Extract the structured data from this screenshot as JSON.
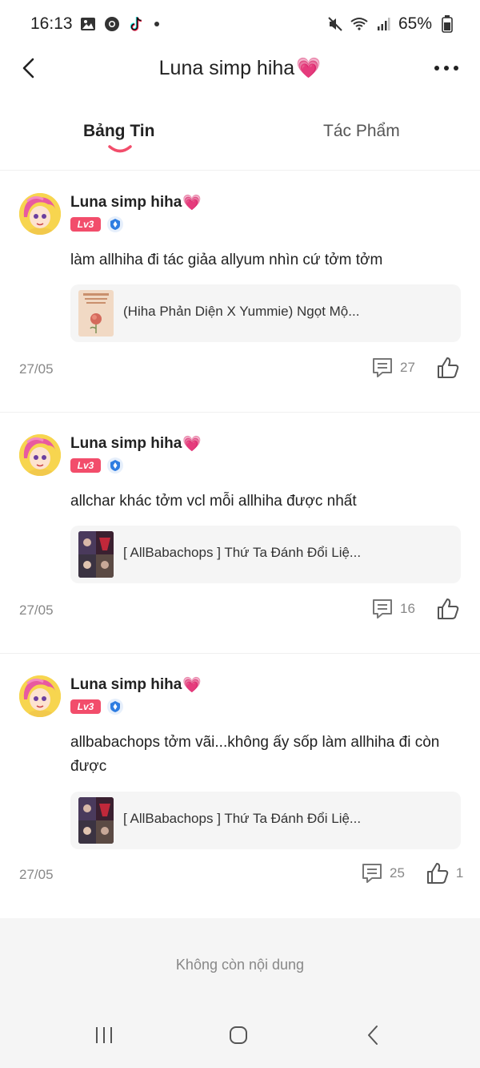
{
  "status_bar": {
    "time": "16:13",
    "battery": "65%",
    "left_icons": [
      "gallery-icon",
      "chrome-icon",
      "tiktok-icon"
    ],
    "right_icons": [
      "mute-icon",
      "wifi-icon",
      "signal-icon",
      "battery-icon"
    ]
  },
  "header": {
    "title": "Luna simp hiha",
    "title_emoji": "💗"
  },
  "tabs": [
    {
      "label": "Bảng Tin",
      "active": true
    },
    {
      "label": "Tác Phẩm",
      "active": false
    }
  ],
  "posts": [
    {
      "author": "Luna simp hiha",
      "author_emoji": "💗",
      "level": "Lv3",
      "text": "làm allhiha đi tác giảa allyum nhìn cứ tởm tởm",
      "book_title": "(Hiha Phản Diện X Yummie) Ngọt Mộ...",
      "date": "27/05",
      "comments": "27",
      "likes": ""
    },
    {
      "author": "Luna simp hiha",
      "author_emoji": "💗",
      "level": "Lv3",
      "text": "allchar khác tởm vcl mỗi allhiha được nhất",
      "book_title": "[ AllBabachops ] Thứ Ta Đánh Đổi Liệ...",
      "date": "27/05",
      "comments": "16",
      "likes": ""
    },
    {
      "author": "Luna simp hiha",
      "author_emoji": "💗",
      "level": "Lv3",
      "text": "allbabachops tởm vãi...không ấy sốp làm allhiha đi còn được",
      "book_title": "[ AllBabachops ] Thứ Ta Đánh Đổi Liệ...",
      "date": "27/05",
      "comments": "25",
      "likes": "1"
    }
  ],
  "end_message": "Không còn nội dung",
  "colors": {
    "accent": "#f24d6b",
    "text": "#222222",
    "muted": "#888888",
    "card_bg": "#f5f5f5"
  }
}
